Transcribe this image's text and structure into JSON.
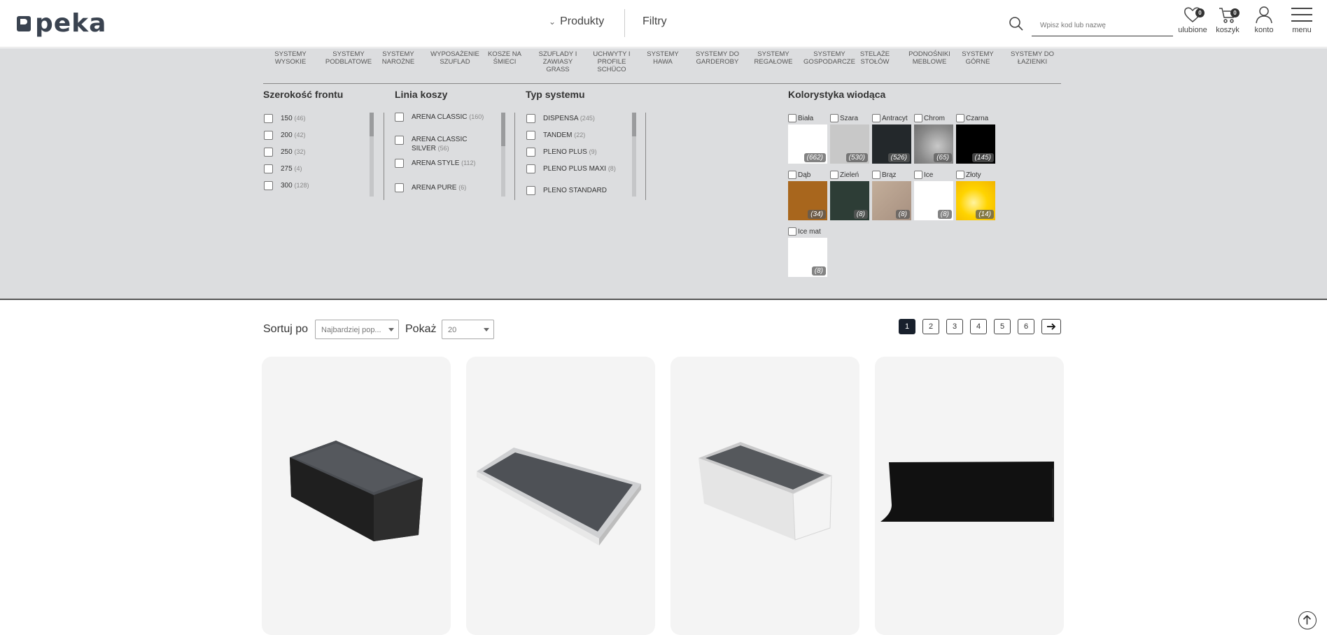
{
  "header": {
    "logo": "peka",
    "nav": {
      "produkty": "Produkty",
      "filtry": "Filtry"
    },
    "search": {
      "placeholder": "Wpisz kod lub nazwę"
    },
    "icons": {
      "favorites": {
        "label": "ulubione",
        "count": "0",
        "icon": "heart-icon"
      },
      "cart": {
        "label": "koszyk",
        "count": "0",
        "icon": "cart-icon"
      },
      "account": {
        "label": "konto",
        "icon": "user-icon"
      },
      "menu": {
        "label": "menu",
        "icon": "hamburger-icon"
      }
    }
  },
  "categories": [
    [
      "SYSTEMY",
      "WYSOKIE"
    ],
    [
      "SYSTEMY",
      "PODBLATOWE"
    ],
    [
      "SYSTEMY",
      "NAROŻNE"
    ],
    [
      "WYPOSAŻENIE",
      "SZUFLAD"
    ],
    [
      "KOSZE NA",
      "ŚMIECI"
    ],
    [
      "SZUFLADY I",
      "ZAWIASY",
      "GRASS"
    ],
    [
      "UCHWYTY I",
      "PROFILE",
      "SCHÜCO"
    ],
    [
      "SYSTEMY",
      "HAWA"
    ],
    [
      "SYSTEMY DO",
      "GARDEROBY"
    ],
    [
      "SYSTEMY",
      "REGAŁOWE"
    ],
    [
      "SYSTEMY",
      "GOSPODARCZE"
    ],
    [
      "STELAŻE",
      "STOŁÓW"
    ],
    [
      "PODNOŚNIKI",
      "MEBLOWE"
    ],
    [
      "SYSTEMY",
      "GÓRNE"
    ],
    [
      "SYSTEMY DO",
      "ŁAZIENKI"
    ]
  ],
  "filters": {
    "width": {
      "title": "Szerokość frontu",
      "items": [
        {
          "name": "150",
          "count": "(46)"
        },
        {
          "name": "200",
          "count": "(42)"
        },
        {
          "name": "250",
          "count": "(32)"
        },
        {
          "name": "275",
          "count": "(4)"
        },
        {
          "name": "300",
          "count": "(128)"
        }
      ]
    },
    "line": {
      "title": "Linia koszy",
      "items": [
        {
          "name": "ARENA CLASSIC",
          "count": "(160)"
        },
        {
          "name": "ARENA CLASSIC SILVER",
          "count": "(56)"
        },
        {
          "name": "ARENA STYLE",
          "count": "(112)"
        },
        {
          "name": "ARENA PURE",
          "count": "(6)"
        }
      ]
    },
    "system": {
      "title": "Typ systemu",
      "items": [
        {
          "name": "DISPENSA",
          "count": "(245)"
        },
        {
          "name": "TANDEM",
          "count": "(22)"
        },
        {
          "name": "PLENO PLUS",
          "count": "(9)"
        },
        {
          "name": "PLENO PLUS MAXI",
          "count": "(8)"
        },
        {
          "name": "PLENO STANDARD",
          "count": ""
        }
      ]
    },
    "colors": {
      "title": "Kolorystyka wiodąca",
      "items": [
        {
          "name": "Biała",
          "count": "(662)",
          "color": "#ffffff"
        },
        {
          "name": "Szara",
          "count": "(530)",
          "color": "#c8c8c8"
        },
        {
          "name": "Antracyt",
          "count": "(526)",
          "color": "#23282b"
        },
        {
          "name": "Chrom",
          "count": "(65)",
          "color": "#9a9a9a"
        },
        {
          "name": "Czarna",
          "count": "(145)",
          "color": "#000000"
        },
        {
          "name": "Dąb",
          "count": "(34)",
          "color": "#a8661d"
        },
        {
          "name": "Zieleń",
          "count": "(8)",
          "color": "#2d3d36"
        },
        {
          "name": "Brąz",
          "count": "(8)",
          "color": "#bba592"
        },
        {
          "name": "Ice",
          "count": "(8)",
          "color": "#ffffff"
        },
        {
          "name": "Złoty",
          "count": "(14)",
          "color": "#ffd400"
        },
        {
          "name": "Ice mat",
          "count": "(8)",
          "color": "#ffffff"
        }
      ]
    }
  },
  "toolbar": {
    "sort_label": "Sortuj po",
    "sort_value": "Najbardziej pop...",
    "show_label": "Pokaż",
    "show_value": "20",
    "pages": [
      "1",
      "2",
      "3",
      "4",
      "5",
      "6"
    ],
    "current_page": "1",
    "next_icon": "arrow-right-icon"
  },
  "products": [
    {
      "icon": "black-drawer-organizer-image"
    },
    {
      "icon": "white-tray-organizer-image"
    },
    {
      "icon": "white-drawer-organizer-image"
    },
    {
      "icon": "black-profile-rail-image"
    }
  ],
  "scroll_top_icon": "arrow-up-icon"
}
